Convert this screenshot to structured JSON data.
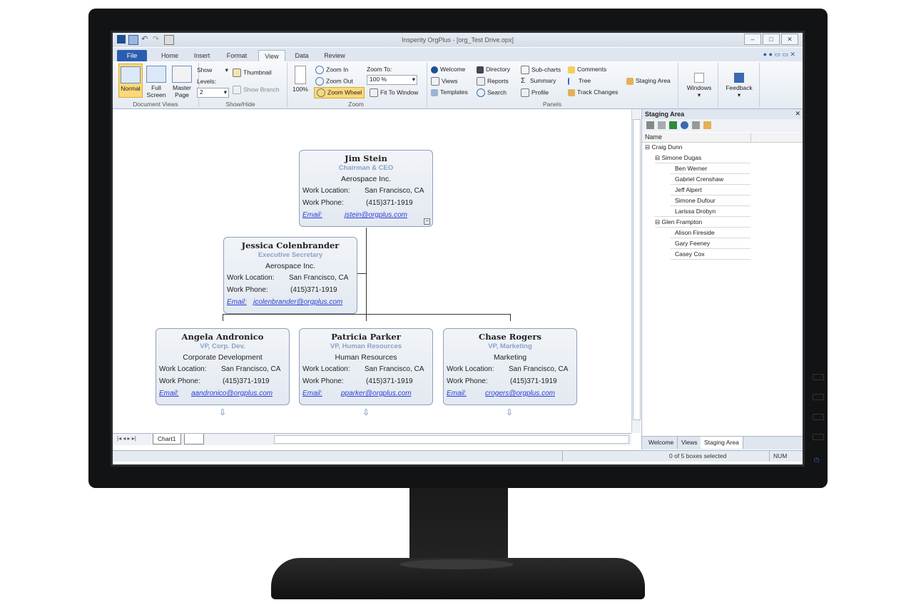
{
  "window": {
    "title": "Insperity OrgPlus - [org_Test Drive.opx]"
  },
  "tabs": [
    "File",
    "Home",
    "Insert",
    "Format",
    "View",
    "Data",
    "Review"
  ],
  "ribbon": {
    "document_views": {
      "label": "Document Views",
      "normal": "Normal",
      "full_screen_1": "Full",
      "full_screen_2": "Screen",
      "master_page_1": "Master",
      "master_page_2": "Page"
    },
    "show_hide": {
      "label": "Show/Hide",
      "show": "Show",
      "levels": "Levels:",
      "levels_value": "2",
      "thumbnail": "Thumbnail",
      "show_branch": "Show Branch"
    },
    "zoom": {
      "label": "Zoom",
      "percent": "100%",
      "zoom_in": "Zoom In",
      "zoom_out": "Zoom Out",
      "zoom_wheel": "Zoom Wheel",
      "zoom_to": "Zoom To:",
      "zoom_value": "100 %",
      "fit_to_window": "Fit To Window"
    },
    "panels": {
      "label": "Panels",
      "welcome": "Welcome",
      "views": "Views",
      "templates": "Templates",
      "directory": "Directory",
      "reports": "Reports",
      "search": "Search",
      "sub_charts": "Sub-charts",
      "summary": "Summary",
      "profile": "Profile",
      "comments": "Comments",
      "tree": "Tree",
      "track_changes": "Track Changes",
      "staging_area": "Staging Area"
    },
    "windows": "Windows",
    "feedback": "Feedback"
  },
  "org": {
    "boxes": [
      {
        "name": "Jim Stein",
        "title": "Chairman & CEO",
        "dept": "Aerospace Inc.",
        "location_label": "Work Location:",
        "location": "San Francisco, CA",
        "phone_label": "Work Phone:",
        "phone": "(415)371-1919",
        "email_label": "Email:",
        "email": "jstein@orgplus.com"
      },
      {
        "name": "Jessica Colenbrander",
        "title": "Executive Secretary",
        "dept": "Aerospace Inc.",
        "location_label": "Work Location:",
        "location": "San Francisco, CA",
        "phone_label": "Work Phone:",
        "phone": "(415)371-1919",
        "email_label": "Email:",
        "email": "jcolenbrander@orgplus.com"
      },
      {
        "name": "Angela Andronico",
        "title": "VP, Corp. Dev.",
        "dept": "Corporate Development",
        "location_label": "Work Location:",
        "location": "San Francisco, CA",
        "phone_label": "Work Phone:",
        "phone": "(415)371-1919",
        "email_label": "Email:",
        "email": "aandronico@orgplus.com"
      },
      {
        "name": "Patricia Parker",
        "title": "VP, Human Resources",
        "dept": "Human Resources",
        "location_label": "Work Location:",
        "location": "San Francisco, CA",
        "phone_label": "Work Phone:",
        "phone": "(415)371-1919",
        "email_label": "Email:",
        "email": "pparker@orgplus.com"
      },
      {
        "name": "Chase Rogers",
        "title": "VP, Marketing",
        "dept": "Marketing",
        "location_label": "Work Location:",
        "location": "San Francisco, CA",
        "phone_label": "Work Phone:",
        "phone": "(415)371-1919",
        "email_label": "Email:",
        "email": "crogers@orgplus.com"
      }
    ]
  },
  "sheet": {
    "tab": "Chart1"
  },
  "staging": {
    "title": "Staging Area",
    "column": "Name",
    "tree": [
      "Craig Dunn",
      "Simone Dugas",
      "Ben Werner",
      "Gabriel Crenshaw",
      "Jeff Alpert",
      "Simone Dufour",
      "Larissa Drobyn",
      "Glen Frampton",
      "Alison Fireside",
      "Gary Feeney",
      "Casey Cox"
    ],
    "tabs": [
      "Welcome",
      "Views",
      "Staging Area"
    ]
  },
  "status": {
    "selection": "0 of 5 boxes selected",
    "num": "NUM"
  }
}
